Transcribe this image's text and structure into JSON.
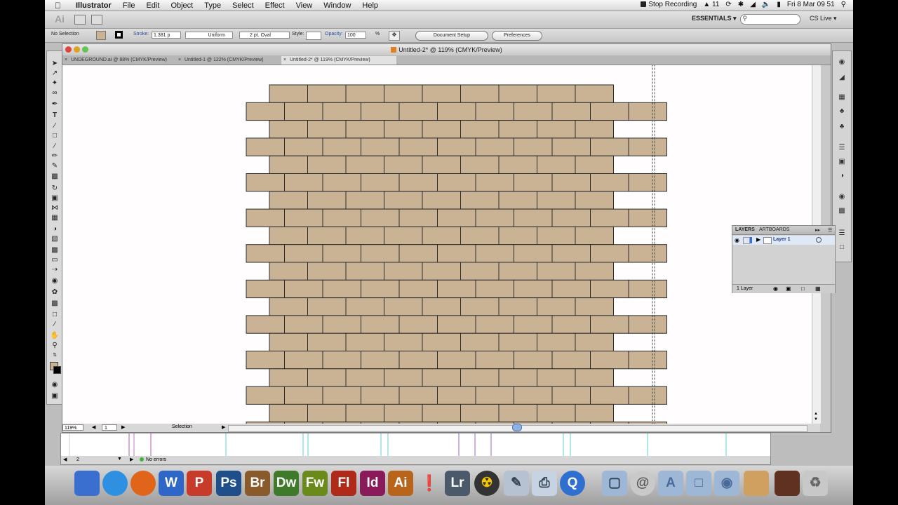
{
  "menubar": {
    "app": "Illustrator",
    "menus": [
      "File",
      "Edit",
      "Object",
      "Type",
      "Select",
      "Effect",
      "View",
      "Window",
      "Help"
    ],
    "stop_recording": "Stop Recording",
    "badge": "11",
    "datetime": "Fri 8 Mar  09 51"
  },
  "appbar": {
    "logo": "Ai",
    "workspace": "ESSENTIALS ▾",
    "search_placeholder": "",
    "cs_live": "CS Live ▾"
  },
  "control": {
    "selection": "No Selection",
    "stroke_label": "Stroke:",
    "stroke_value": "1.381 p",
    "profile": "Uniform",
    "brush": "2 pt. Oval",
    "style_label": "Style:",
    "opacity_label": "Opacity:",
    "opacity_value": "100",
    "percent": "%",
    "document_setup": "Document Setup",
    "preferences": "Preferences"
  },
  "document": {
    "title": "Untitled-2* @ 119% (CMYK/Preview)",
    "tabs": [
      {
        "label": "UNDEGROUND.ai @ 88% (CMYK/Preview)"
      },
      {
        "label": "Untitled-1 @ 122% (CMYK/Preview)"
      },
      {
        "label": "Untitled-2* @ 119% (CMYK/Preview)"
      }
    ],
    "zoom": "119%",
    "artboard": "1",
    "status": "Selection",
    "brick_color": "#c9b394"
  },
  "layers": {
    "tabs": [
      "LAYERS",
      "ARTBOARDS"
    ],
    "layer_name": "Layer 1",
    "count": "1 Layer"
  },
  "window2": {
    "page": "2",
    "errors": "No errors"
  },
  "dock": [
    {
      "label": "",
      "color": "#3a6fd0"
    },
    {
      "label": "",
      "color": "#2f8fe0"
    },
    {
      "label": "",
      "color": "#e0641a"
    },
    {
      "label": "W",
      "color": "#2f67c8"
    },
    {
      "label": "P",
      "color": "#c83a2a"
    },
    {
      "label": "Ps",
      "color": "#1f4f8a"
    },
    {
      "label": "Br",
      "color": "#8a5a2a"
    },
    {
      "label": "Dw",
      "color": "#3e7a2a"
    },
    {
      "label": "Fw",
      "color": "#6a8a1a"
    },
    {
      "label": "Fl",
      "color": "#b02a1a"
    },
    {
      "label": "Id",
      "color": "#8a1a5a"
    },
    {
      "label": "Ai",
      "color": "#b8641a"
    },
    {
      "label": "",
      "color": "#e8e8e8"
    },
    {
      "label": "Lr",
      "color": "#4a5a6a"
    }
  ]
}
